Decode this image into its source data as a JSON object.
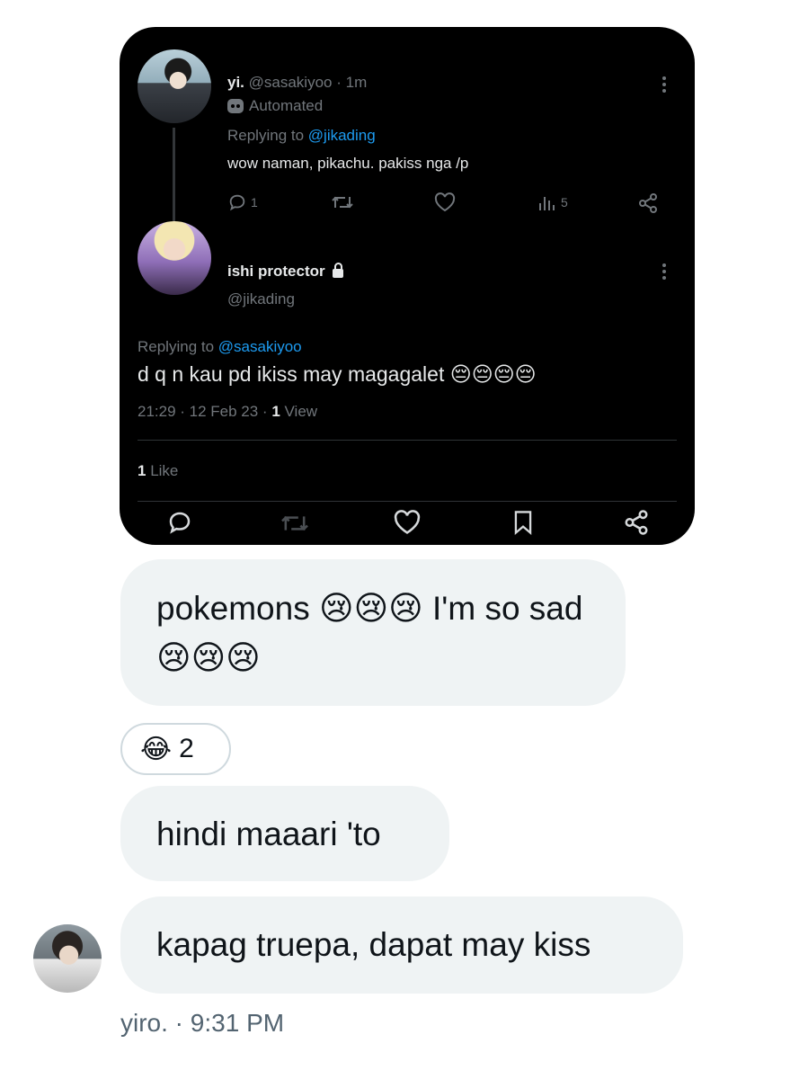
{
  "quoted_tweet": {
    "reply": {
      "display_name": "yi.",
      "handle": "@sasakiyoo",
      "time_sep": " · ",
      "time": "1m",
      "automated_label": "Automated",
      "replying_prefix": "Replying to ",
      "replying_handle": "@jikading",
      "text": "wow naman, pikachu. pakiss nga /p",
      "reply_count": "1",
      "view_count": "5"
    },
    "main": {
      "display_name": "ishi protector",
      "handle": "@jikading",
      "replying_prefix": "Replying to ",
      "replying_handle": "@sasakiyoo",
      "text": "d q n kau pd ikiss may magagalet",
      "text_emoji": "😔😔😔😔",
      "timestamp": "21:29 · 12 Feb 23 · ",
      "views_count": "1",
      "views_label": " View",
      "likes_count": "1",
      "likes_label": " Like"
    }
  },
  "messages": [
    {
      "text_html": "pokemons <span class='emoji'>😢😢😢</span> I'm so sad <span class='emoji'>😢😢😢</span>"
    },
    {
      "text": "hindi maaari 'to"
    },
    {
      "text": "kapag truepa, dapat may kiss"
    }
  ],
  "reaction": {
    "emoji": "😂",
    "count": "2"
  },
  "sender": {
    "name": "yiro.",
    "sep": " · ",
    "time": "9:31 PM"
  },
  "colors": {
    "link": "#1d9bf0",
    "card_bg": "#000000",
    "bubble_bg": "#eff3f4"
  }
}
